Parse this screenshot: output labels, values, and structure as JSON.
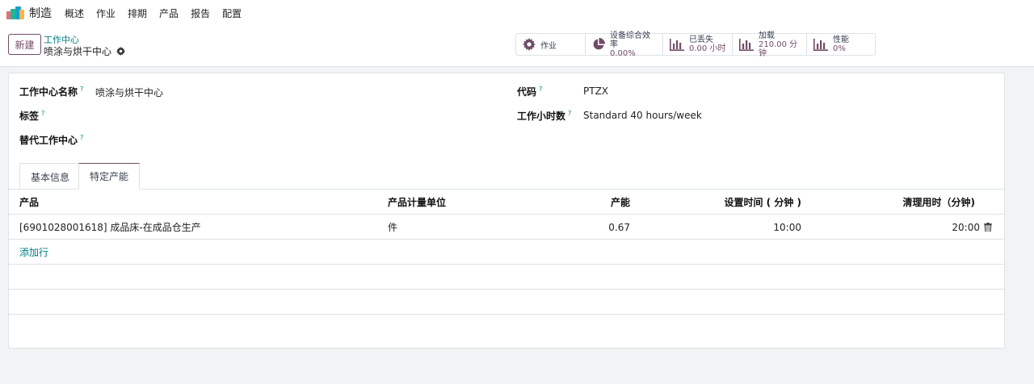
{
  "app": {
    "name": "制造"
  },
  "menu": [
    "概述",
    "作业",
    "排期",
    "产品",
    "报告",
    "配置"
  ],
  "control": {
    "new_label": "新建",
    "breadcrumb_parent": "工作中心",
    "breadcrumb_current": "喷涂与烘干中心"
  },
  "smart_buttons": [
    {
      "icon": "gear-icon",
      "label": "作业"
    },
    {
      "icon": "pie-chart-icon",
      "label": "设备综合效率",
      "value": "0.00%"
    },
    {
      "icon": "bar-chart-icon",
      "label": "已丢失",
      "value": "0.00 小时"
    },
    {
      "icon": "bar-chart-icon",
      "label": "加载",
      "value": "210.00 分钟"
    },
    {
      "icon": "bar-chart-icon",
      "label": "性能",
      "value": "0%"
    }
  ],
  "form": {
    "name_label": "工作中心名称",
    "name_value": "喷涂与烘干中心",
    "tags_label": "标签",
    "alt_label": "替代工作中心",
    "code_label": "代码",
    "code_value": "PTZX",
    "hours_label": "工作小时数",
    "hours_value": "Standard 40 hours/week",
    "help_mark": "?"
  },
  "tabs": [
    "基本信息",
    "特定产能"
  ],
  "table": {
    "headers": [
      "产品",
      "产品计量单位",
      "产能",
      "设置时间 ( 分钟 )",
      "清理用时（分钟)"
    ],
    "rows": [
      [
        "[6901028001618] 成品床-在成品仓生产",
        "件",
        "0.67",
        "10:00",
        "20:00"
      ]
    ],
    "add_line": "添加行"
  },
  "colors": {
    "brand": "#714b67",
    "link": "#017e84"
  }
}
